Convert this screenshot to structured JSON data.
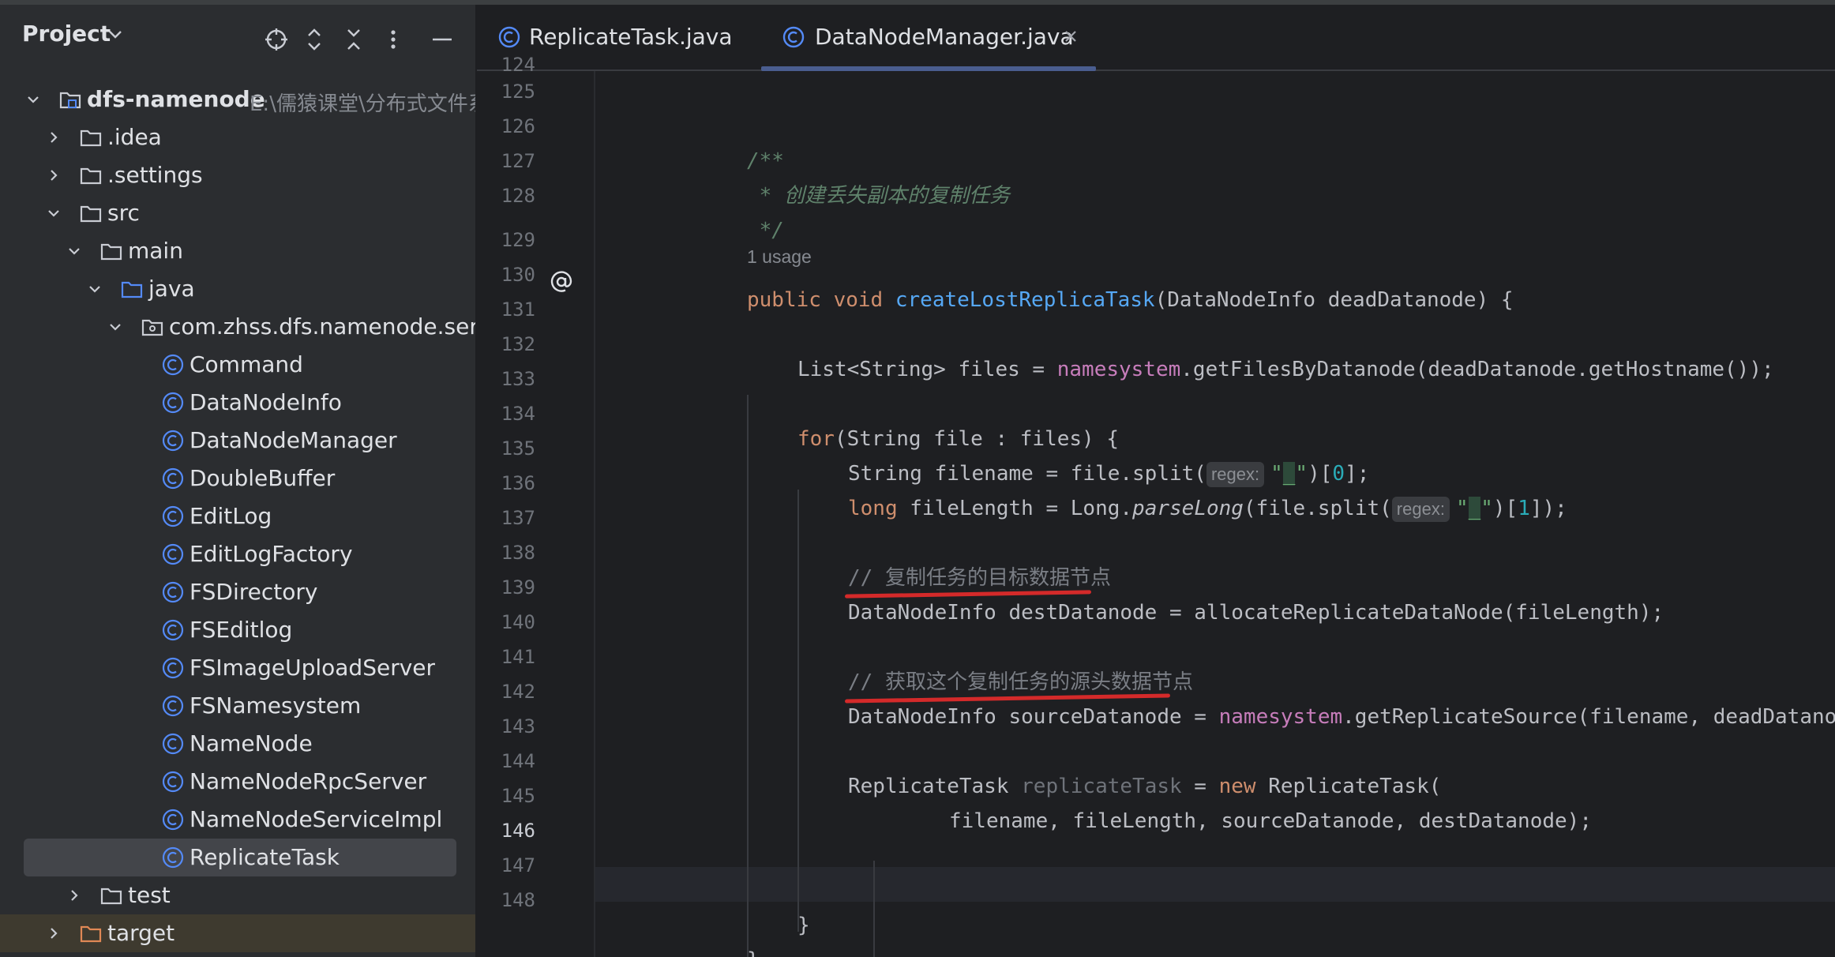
{
  "project_panel": {
    "title": "Project",
    "toolbar_icons": [
      "locate-icon",
      "expand-collapse-icon",
      "collapse-all-icon",
      "more-icon",
      "hide-icon"
    ],
    "tree": [
      {
        "label": "dfs-namenode",
        "path": "E:\\儒猿课堂\\分布式文件系",
        "type": "module",
        "expanded": true
      },
      {
        "label": ".idea",
        "type": "folder",
        "expanded": false
      },
      {
        "label": ".settings",
        "type": "folder",
        "expanded": false
      },
      {
        "label": "src",
        "type": "folder",
        "expanded": true
      },
      {
        "label": "main",
        "type": "folder",
        "expanded": true
      },
      {
        "label": "java",
        "type": "source-folder",
        "expanded": true
      },
      {
        "label": "com.zhss.dfs.namenode.ser",
        "type": "package",
        "expanded": true
      },
      {
        "label": "Command",
        "type": "class"
      },
      {
        "label": "DataNodeInfo",
        "type": "class"
      },
      {
        "label": "DataNodeManager",
        "type": "class"
      },
      {
        "label": "DoubleBuffer",
        "type": "class"
      },
      {
        "label": "EditLog",
        "type": "class"
      },
      {
        "label": "EditLogFactory",
        "type": "class"
      },
      {
        "label": "FSDirectory",
        "type": "class"
      },
      {
        "label": "FSEditlog",
        "type": "class"
      },
      {
        "label": "FSImageUploadServer",
        "type": "class"
      },
      {
        "label": "FSNamesystem",
        "type": "class"
      },
      {
        "label": "NameNode",
        "type": "class"
      },
      {
        "label": "NameNodeRpcServer",
        "type": "class"
      },
      {
        "label": "NameNodeServiceImpl",
        "type": "class"
      },
      {
        "label": "ReplicateTask",
        "type": "class",
        "selected": true
      },
      {
        "label": "test",
        "type": "folder",
        "expanded": false
      },
      {
        "label": "target",
        "type": "excluded-folder",
        "expanded": false
      }
    ]
  },
  "editor": {
    "tabs": [
      {
        "label": "ReplicateTask.java",
        "active": false
      },
      {
        "label": "DataNodeManager.java",
        "active": true
      }
    ],
    "line_numbers": [
      "124",
      "125",
      "126",
      "127",
      "128",
      "129",
      "130",
      "131",
      "132",
      "133",
      "134",
      "135",
      "136",
      "137",
      "138",
      "139",
      "140",
      "141",
      "142",
      "143",
      "144",
      "145",
      "146",
      "147",
      "148"
    ],
    "current_line": "146",
    "usage_hint": "1 usage",
    "hint_regex": "regex:",
    "code": {
      "l126": "/**",
      "l127_star": " * ",
      "l127_text": "创建丢失副本的复制任务",
      "l128": " */",
      "l129": {
        "kw1": "public",
        "kw2": "void",
        "method": "createLostReplicaTask",
        "params": "(DataNodeInfo deadDatanode) {"
      },
      "l131": {
        "a": "List<String> files = ",
        "field": "namesystem",
        "b": ".getFilesByDatanode(deadDatanode.getHostname());"
      },
      "l133": {
        "kw": "for",
        "rest": "(String file : files) {"
      },
      "l134": {
        "a": "String filename = file.split(",
        "s1": "\"",
        "sep": "_",
        "s2": "\"",
        "b": ")[",
        "idx": "0",
        "c": "];"
      },
      "l135": {
        "kw": "long",
        "a": " fileLength = Long.",
        "it": "parseLong",
        "b": "(file.split(",
        "s1": "\"",
        "sep": "_",
        "s2": "\"",
        "c": ")[",
        "idx": "1",
        "d": "]);"
      },
      "l137": {
        "slashes": "// ",
        "text": "复制任务的目标数据节点"
      },
      "l138": "DataNodeInfo destDatanode = allocateReplicateDataNode(fileLength);",
      "l140": {
        "slashes": "// ",
        "text": "获取这个复制任务的源头数据节点"
      },
      "l141": {
        "a": "DataNodeInfo sourceDatanode = ",
        "field": "namesystem",
        "b": ".getReplicateSource(filename, deadDatanode);"
      },
      "l143": {
        "a": "ReplicateTask ",
        "unused": "replicateTask",
        "b": " = ",
        "kw": "new",
        "c": " ReplicateTask("
      },
      "l144": "filename, fileLength, sourceDatanode, destDatanode);",
      "l147": "}",
      "l148": "}"
    }
  },
  "colors": {
    "background": "#1e1f22",
    "panel": "#2b2d30",
    "keyword": "#cf8e6d",
    "method": "#56a8f5",
    "field": "#c77dbb",
    "number": "#2aacb8",
    "string": "#6aab73",
    "comment": "#7a7e85",
    "annotation_underline": "#d42a2a"
  }
}
